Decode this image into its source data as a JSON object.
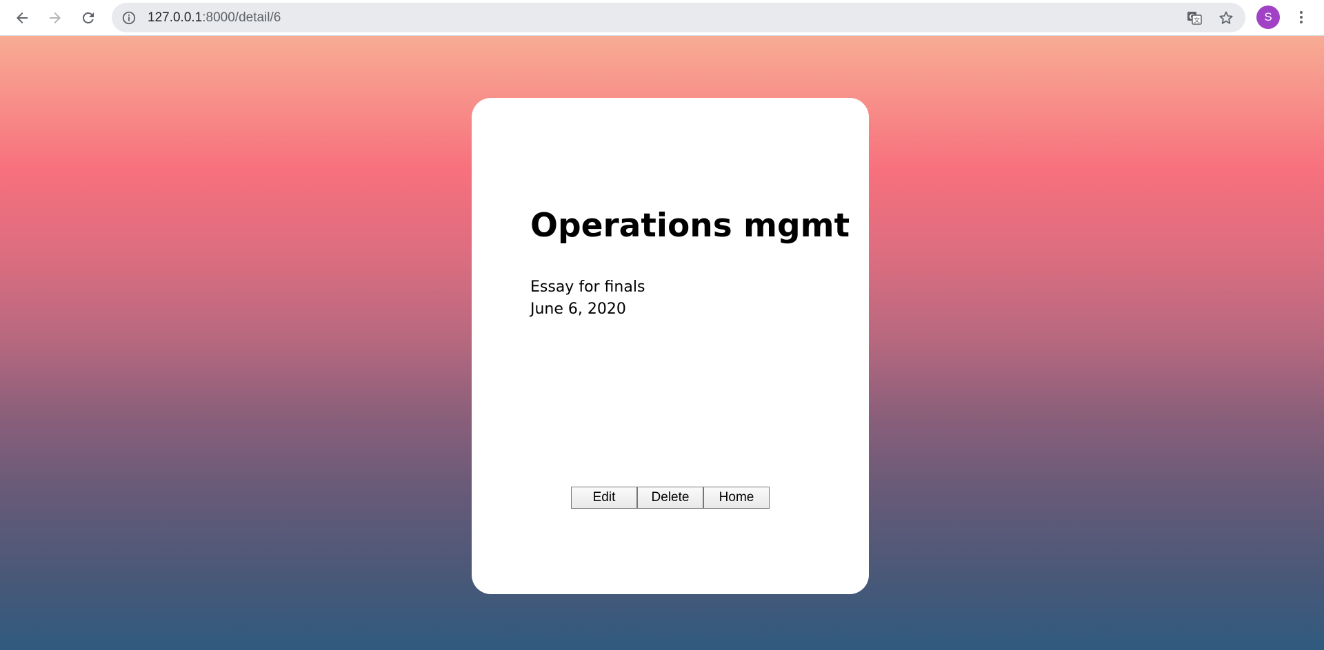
{
  "browser": {
    "url_host": "127.0.0.1",
    "url_rest": ":8000/detail/6",
    "avatar_letter": "S",
    "avatar_color": "#a142c6",
    "icons": [
      "back-arrow-icon",
      "forward-arrow-icon",
      "reload-icon",
      "info-icon",
      "translate-icon",
      "star-icon",
      "more-vert-icon"
    ]
  },
  "detail": {
    "title": "Operations mgmt",
    "description": "Essay for finals",
    "date": "June 6, 2020"
  },
  "actions": {
    "edit_label": "Edit",
    "delete_label": "Delete",
    "home_label": "Home"
  },
  "colors": {
    "gradient_top": "#f7ac94",
    "gradient_mid": "#f7707d",
    "gradient_bottom": "#305a7e",
    "card_background": "#ffffff"
  }
}
